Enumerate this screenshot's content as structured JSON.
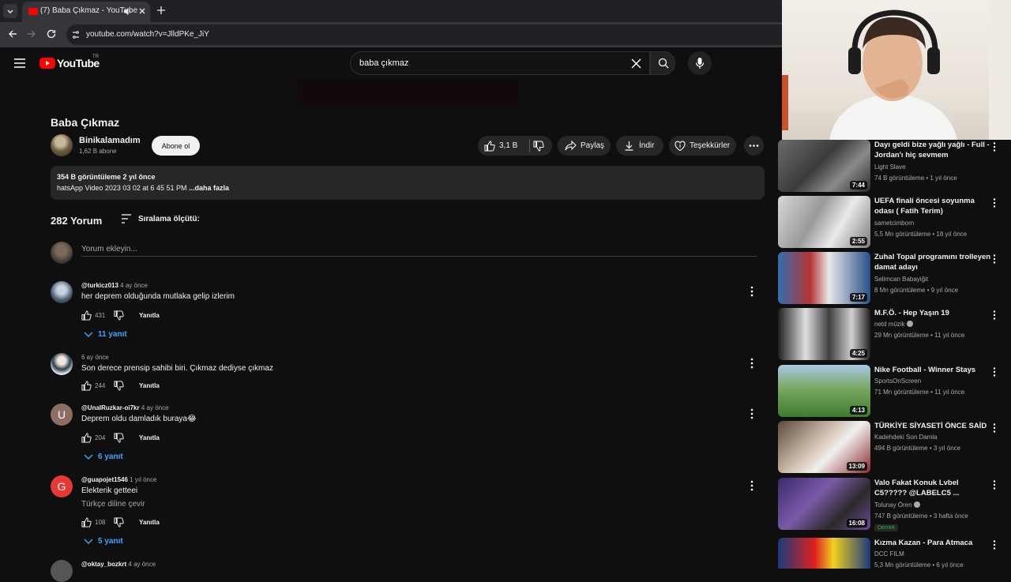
{
  "browser": {
    "tab_title": "(7) Baba Çıkmaz - YouTube",
    "url": "youtube.com/watch?v=JlldPKe_JiY"
  },
  "header": {
    "logo_text": "YouTube",
    "country_code": "TR",
    "search_query": "baba çıkmaz"
  },
  "video": {
    "title": "Baba Çıkmaz",
    "channel": "Binikalamadım",
    "subscribers": "1,62 B abone",
    "subscribe_label": "Abone ol",
    "likes": "3,1 B",
    "share_label": "Paylaş",
    "download_label": "İndir",
    "thanks_label": "Teşekkürler",
    "stats": "354 B görüntüleme  2 yıl önce",
    "description": "hatsApp Video 2023 03 02 at 6 45 51 PM ",
    "description_more": "...daha fazla"
  },
  "comments": {
    "count_label": "282 Yorum",
    "sort_label": "Sıralama ölçütü:",
    "add_placeholder": "Yorum ekleyin...",
    "reply_label": "Yanıtla",
    "items": [
      {
        "author": "@turkicz013",
        "time": "4 ay önce",
        "text": "her deprem olduğunda mutlaka gelip izlerim",
        "text2": "",
        "likes": "431",
        "replies": "11 yanıt",
        "letter": "",
        "avatar_color": ""
      },
      {
        "author": "",
        "time": "6 ay önce",
        "text": "Son derece prensip sahibi biri. Çıkmaz dediyse çıkmaz",
        "text2": "",
        "likes": "244",
        "replies": "",
        "letter": "",
        "avatar_color": ""
      },
      {
        "author": "@UnalRuzkar-oi7kr",
        "time": "4 ay önce",
        "text": "Deprem oldu damladık buraya😂",
        "text2": "",
        "likes": "204",
        "replies": "6 yanıt",
        "letter": "U",
        "avatar_color": "#8d6e63"
      },
      {
        "author": "@guapojet1546",
        "time": "1 yıl önce",
        "text": "Elekterik getteei",
        "text2": "Türkçe diline çevir",
        "likes": "108",
        "replies": "5 yanıt",
        "letter": "G",
        "avatar_color": "#e53935"
      },
      {
        "author": "@oktay_bozkrt",
        "time": "4 ay önce",
        "text": "",
        "text2": "",
        "likes": "",
        "replies": "",
        "letter": "",
        "avatar_color": ""
      }
    ]
  },
  "recommendations": [
    {
      "title": "Dayı geldi bize yağlı yağlı - Full - Jordan'ı hiç sevmem",
      "channel": "Light Slave",
      "stats": "74 B görüntüleme • 1 yıl önce",
      "duration": "7:44",
      "verified": false,
      "badge": ""
    },
    {
      "title": "UEFA finali öncesi soyunma odası ( Fatih Terim)",
      "channel": "sametcimborn",
      "stats": "5,5 Mn görüntüleme • 18 yıl önce",
      "duration": "2:55",
      "verified": false,
      "badge": ""
    },
    {
      "title": "Zuhal Topal programını trolleyen damat adayı",
      "channel": "Selimcan Babayiğit",
      "stats": "8 Mn görüntüleme • 9 yıl önce",
      "duration": "7:17",
      "verified": false,
      "badge": ""
    },
    {
      "title": "M.F.Ö. - Hep Yaşın 19",
      "channel": "netd müzik",
      "stats": "29 Mn görüntüleme • 11 yıl önce",
      "duration": "4:25",
      "verified": true,
      "badge": ""
    },
    {
      "title": "Nike Football - Winner Stays",
      "channel": "SportsOnScreen",
      "stats": "71 Mn görüntüleme • 11 yıl önce",
      "duration": "4:13",
      "verified": false,
      "badge": ""
    },
    {
      "title": "TÜRKİYE SİYASETİ ÖNCE SAİD",
      "channel": "Kadehdeki Son Damla",
      "stats": "494 B görüntüleme • 3 yıl önce",
      "duration": "13:09",
      "verified": false,
      "badge": ""
    },
    {
      "title": "Valo Fakat Konuk Lvbel C5????? @LABELC5 ...",
      "channel": "Tolunay Ören",
      "stats": "747 B görüntüleme • 3 hafta önce",
      "duration": "16:08",
      "verified": true,
      "badge": "Demek"
    },
    {
      "title": "Kızma Kazan - Para Atmaca",
      "channel": "DCC FILM",
      "stats": "5,3 Mn görüntüleme • 6 yıl önce",
      "duration": "",
      "verified": false,
      "badge": ""
    }
  ],
  "colors": {
    "background": "#0f0f0f",
    "accent_blue": "#3ea6ff",
    "youtube_red": "#ff0000",
    "pill": "#272727"
  }
}
